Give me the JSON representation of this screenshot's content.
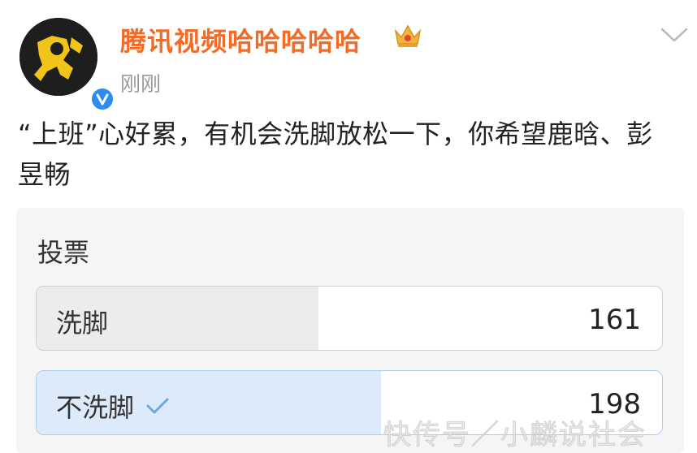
{
  "post": {
    "username": "腾讯视频哈哈哈哈哈",
    "timestamp": "刚刚",
    "text": "“上班”心好累，有机会洗脚放松一下，你希望鹿晗、彭昱畅"
  },
  "poll": {
    "title": "投票",
    "options": [
      {
        "label": "洗脚",
        "count": "161",
        "fraction": 0.45,
        "selected": false
      },
      {
        "label": "不洗脚",
        "count": "198",
        "fraction": 0.55,
        "selected": true
      }
    ]
  },
  "watermark": "快传号／小麟说社会",
  "icons": {
    "avatar": "avatar-illustration",
    "verified": "verified-badge-icon",
    "crown": "crown-icon",
    "menu": "chevron-down-icon",
    "selected": "checkmark-icon"
  },
  "colors": {
    "username": "#f26b27",
    "avatar_bg": "#1e1e1e",
    "avatar_figure": "#f0c419",
    "verified": "#2d8cf0",
    "selected_fill": "#dceafa",
    "selected_border": "#a9ccee",
    "option_fill": "#ececec"
  }
}
